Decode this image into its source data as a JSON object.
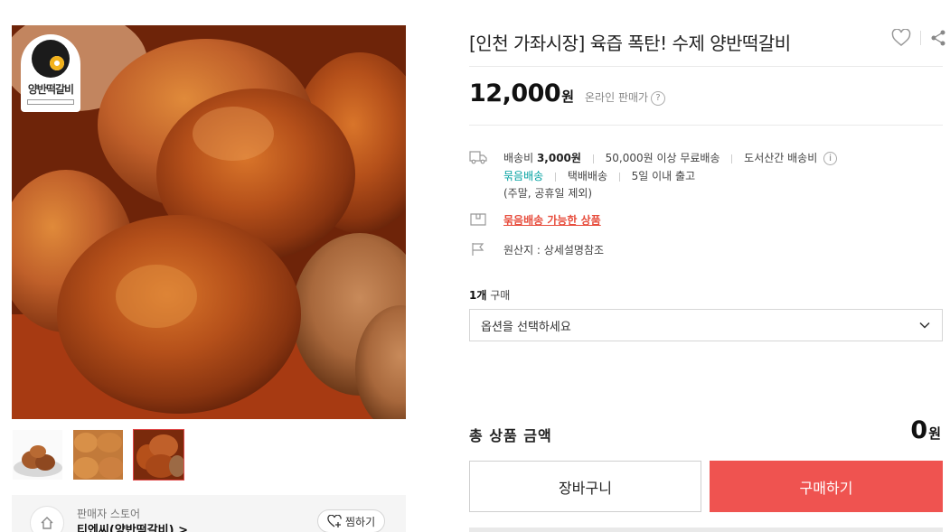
{
  "gallery": {
    "main_image_alt": "main-product-photo",
    "brand_logo_text": "양반떡갈비",
    "thumbnails": [
      {
        "name": "thumb-1"
      },
      {
        "name": "thumb-2"
      },
      {
        "name": "thumb-3",
        "active": true
      }
    ]
  },
  "seller": {
    "tag": "판매자 스토어",
    "name": "티엔씨(양반떡갈비) >",
    "follow_label": "찜하기"
  },
  "product": {
    "title": "[인천 가좌시장] 육즙 폭탄! 수제 양반떡갈비",
    "price": "12,000",
    "price_unit": "원",
    "price_note": "온라인 판매가"
  },
  "delivery": {
    "fee_label": "배송비",
    "fee_value": "3,000원",
    "free_condition": "50,000원 이상 무료배송",
    "island_fee": "도서산간 배송비",
    "bundle": "묶음배송",
    "courier": "택배배송",
    "ship_time": "5일 이내 출고",
    "exclusion": "(주말, 공휴일 제외)"
  },
  "bundle_notice": "묶음배송 가능한 상품",
  "origin": "원산지 : 상세설명참조",
  "purchase": {
    "qty_count": "1개",
    "qty_label": "구매",
    "option_placeholder": "옵션을 선택하세요",
    "total_label": "총 상품 금액",
    "total_value": "0",
    "total_unit": "원",
    "cart_label": "장바구니",
    "buy_label": "구매하기"
  },
  "colors": {
    "buy_button": "#ef5350",
    "bundle_teal": "#00a0a0",
    "link_red": "#e74c3c"
  },
  "icons": [
    "heart-icon",
    "share-icon",
    "truck-icon",
    "box-icon",
    "flag-icon",
    "help-icon",
    "info-icon",
    "chevron-down-icon",
    "home-icon",
    "heart-plus-icon"
  ]
}
